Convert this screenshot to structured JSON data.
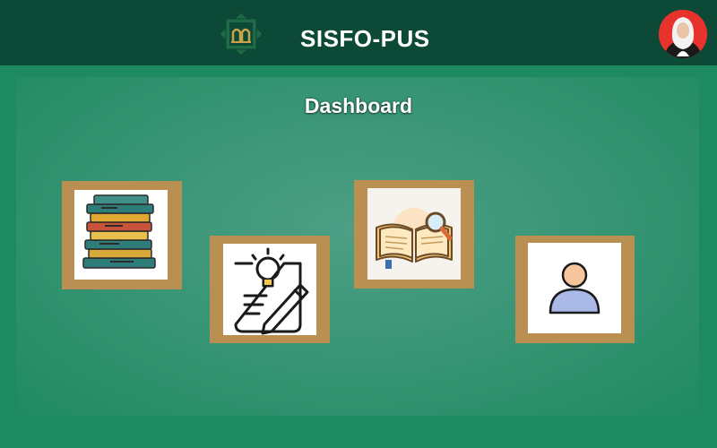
{
  "header": {
    "app_title": "SISFO-PUS",
    "logo_icon": "library-logo-icon",
    "avatar_icon": "user-avatar-photo"
  },
  "main": {
    "page_title": "Dashboard",
    "tiles": [
      {
        "icon": "book-stack-icon"
      },
      {
        "icon": "idea-notes-pencil-icon"
      },
      {
        "icon": "open-book-search-icon"
      },
      {
        "icon": "user-profile-icon"
      }
    ]
  },
  "colors": {
    "header_bg": "#0c4a37",
    "page_bg": "#1e8a62",
    "tile_frame": "#b98f52",
    "title_text": "#ffffff"
  }
}
